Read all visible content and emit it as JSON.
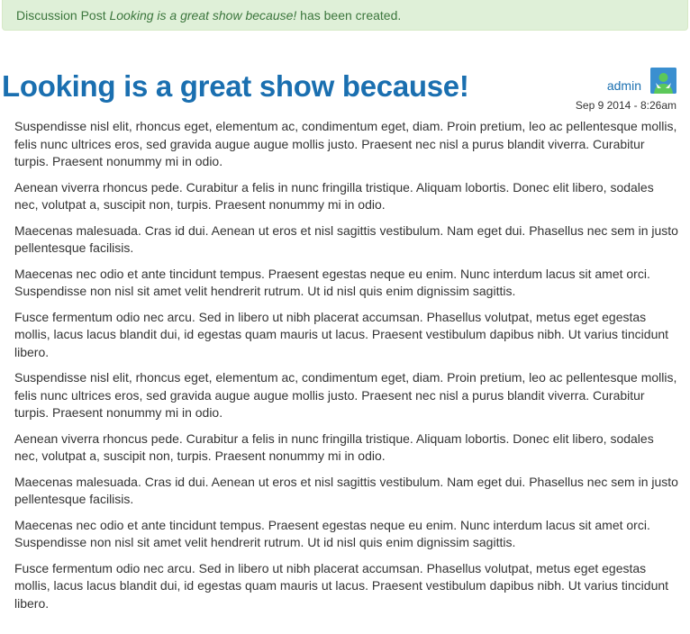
{
  "alert": {
    "prefix": "Discussion Post ",
    "title": "Looking is a great show because!",
    "suffix": " has been created."
  },
  "post": {
    "title": "Looking is a great show because!",
    "author": "admin",
    "date": "Sep 9 2014 - 8:26am",
    "paragraphs": [
      "Suspendisse nisl elit, rhoncus eget, elementum ac, condimentum eget, diam. Proin pretium, leo ac pellentesque mollis, felis nunc ultrices eros, sed gravida augue augue mollis justo. Praesent nec nisl a purus blandit viverra. Curabitur turpis. Praesent nonummy mi in odio.",
      "Aenean viverra rhoncus pede. Curabitur a felis in nunc fringilla tristique. Aliquam lobortis. Donec elit libero, sodales nec, volutpat a, suscipit non, turpis. Praesent nonummy mi in odio.",
      "Maecenas malesuada. Cras id dui. Aenean ut eros et nisl sagittis vestibulum. Nam eget dui. Phasellus nec sem in justo pellentesque facilisis.",
      "Maecenas nec odio et ante tincidunt tempus. Praesent egestas neque eu enim. Nunc interdum lacus sit amet orci. Suspendisse non nisl sit amet velit hendrerit rutrum. Ut id nisl quis enim dignissim sagittis.",
      "Fusce fermentum odio nec arcu. Sed in libero ut nibh placerat accumsan. Phasellus volutpat, metus eget egestas mollis, lacus lacus blandit dui, id egestas quam mauris ut lacus. Praesent vestibulum dapibus nibh. Ut varius tincidunt libero.",
      "Suspendisse nisl elit, rhoncus eget, elementum ac, condimentum eget, diam. Proin pretium, leo ac pellentesque mollis, felis nunc ultrices eros, sed gravida augue augue mollis justo. Praesent nec nisl a purus blandit viverra. Curabitur turpis. Praesent nonummy mi in odio.",
      "Aenean viverra rhoncus pede. Curabitur a felis in nunc fringilla tristique. Aliquam lobortis. Donec elit libero, sodales nec, volutpat a, suscipit non, turpis. Praesent nonummy mi in odio.",
      "Maecenas malesuada. Cras id dui. Aenean ut eros et nisl sagittis vestibulum. Nam eget dui. Phasellus nec sem in justo pellentesque facilisis.",
      "Maecenas nec odio et ante tincidunt tempus. Praesent egestas neque eu enim. Nunc interdum lacus sit amet orci. Suspendisse non nisl sit amet velit hendrerit rutrum. Ut id nisl quis enim dignissim sagittis.",
      "Fusce fermentum odio nec arcu. Sed in libero ut nibh placerat accumsan. Phasellus volutpat, metus eget egestas mollis, lacus lacus blandit dui, id egestas quam mauris ut lacus. Praesent vestibulum dapibus nibh. Ut varius tincidunt libero."
    ]
  },
  "icons": {
    "avatar": "user-avatar-icon"
  },
  "colors": {
    "alert_bg": "#dff0d8",
    "alert_text": "#3c763d",
    "title": "#1a6fb0",
    "link": "#1a6fb0",
    "avatar_bg": "#3a8fd0",
    "avatar_figure": "#5cc85a"
  }
}
